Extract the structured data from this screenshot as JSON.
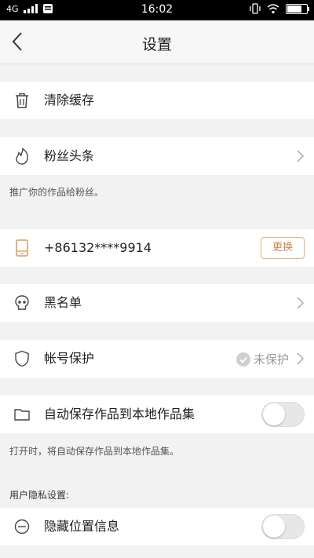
{
  "status_bar": {
    "network": "4G",
    "time": "16:02"
  },
  "header": {
    "title": "设置"
  },
  "items": {
    "clear_cache": {
      "label": "清除缓存"
    },
    "fans_headline": {
      "label": "粉丝头条",
      "note": "推广你的作品给粉丝。"
    },
    "phone": {
      "value": "+86132****9914",
      "button": "更换"
    },
    "blacklist": {
      "label": "黑名单"
    },
    "account_protection": {
      "label": "帐号保护",
      "status": "未保护"
    },
    "auto_save": {
      "label": "自动保存作品到本地作品集",
      "note": "打开时，将自动保存作品到本地作品集。",
      "enabled": false
    },
    "privacy_section": {
      "title": "用户隐私设置:"
    },
    "hide_location": {
      "label": "隐藏位置信息",
      "enabled": false
    }
  },
  "colors": {
    "accent": "#c98b4c",
    "background": "#f2f2f2"
  }
}
